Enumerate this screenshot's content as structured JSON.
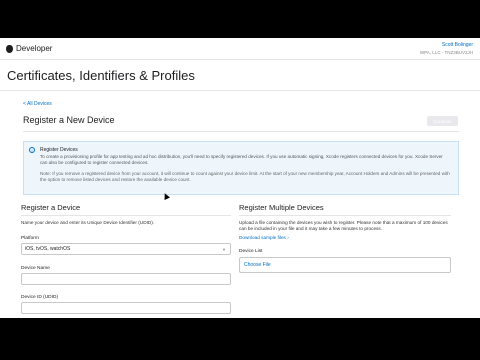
{
  "header": {
    "brand": "Developer",
    "user_name": "Scott Bolinger",
    "team": "WPA, LLC - TNZ3BUV2JH"
  },
  "page_title": "Certificates, Identifiers & Profiles",
  "back_link": "< All Devices",
  "section_title": "Register a New Device",
  "continue_label": "Continue",
  "info": {
    "title": "Register Devices",
    "text": "To create a provisioning profile for app testing and ad hoc distribution, you'll need to specify registered devices. If you use automatic signing, Xcode registers connected devices for you. Xcode Server can also be configured to register connected devices.",
    "note": "Note: If you remove a registered device from your account, it will continue to count against your device limit. At the start of your new membership year, Account Holders and Admins will be presented with the option to remove listed devices and restore the available device count."
  },
  "left": {
    "title": "Register a Device",
    "desc": "Name your device and enter its Unique Device Identifier (UDID).",
    "platform_label": "Platform",
    "platform_value": "iOS, tvOS, watchOS",
    "name_label": "Device Name",
    "udid_label": "Device ID (UDID)"
  },
  "right": {
    "title": "Register Multiple Devices",
    "desc": "Upload a file containing the devices you wish to register. Please note that a maximum of 100 devices can be included in your file and it may take a few minutes to process.",
    "download_link": "Download sample files ›",
    "list_label": "Device List",
    "choose_file": "Choose File"
  }
}
